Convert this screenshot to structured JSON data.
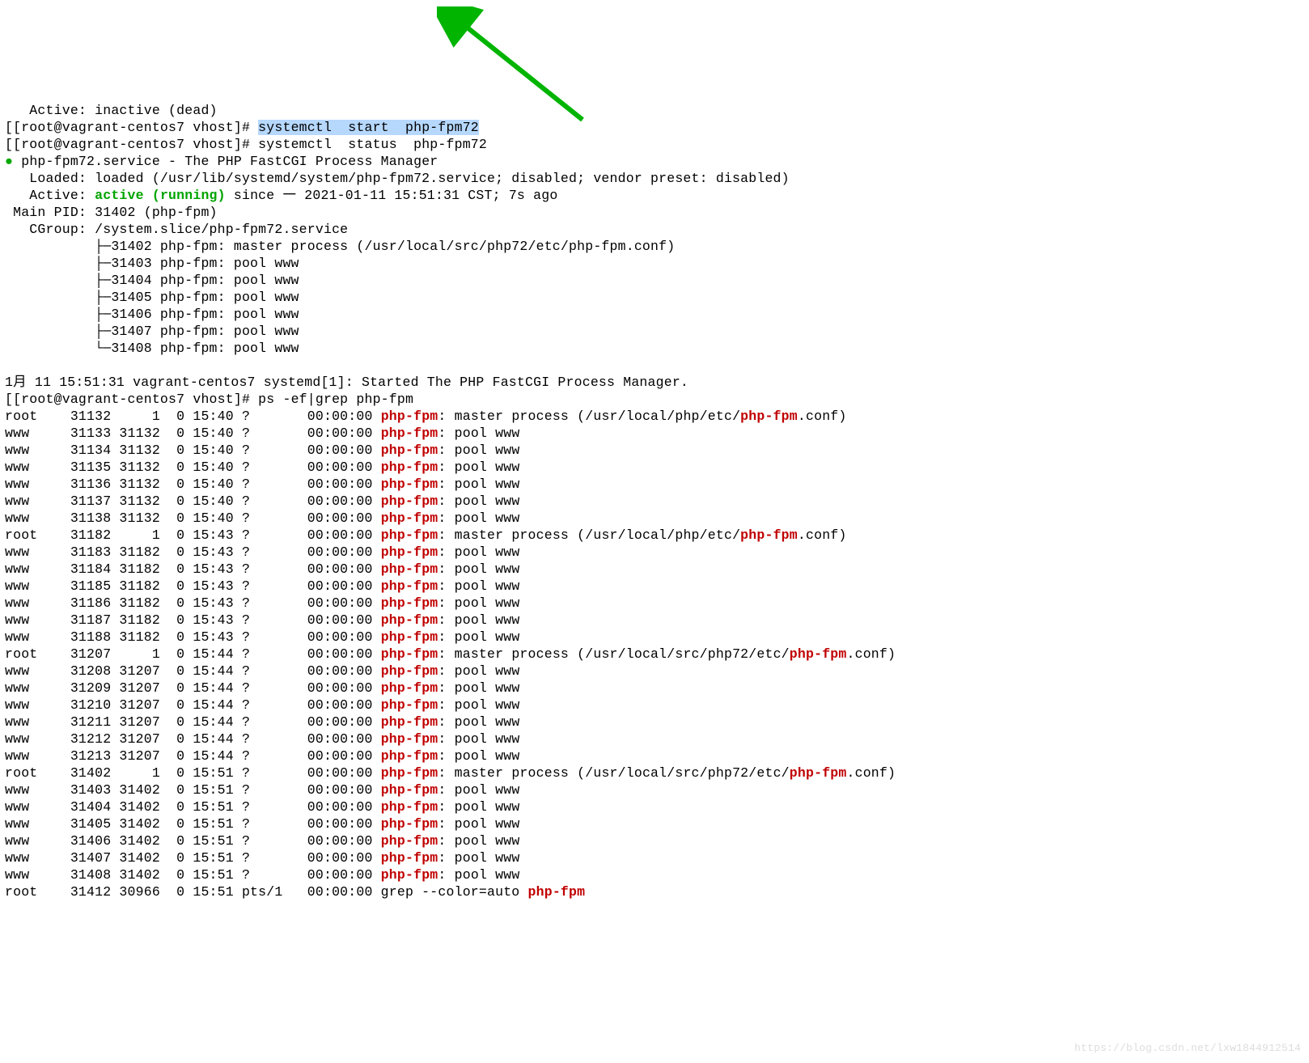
{
  "prompt": "[[root@vagrant-centos7 vhost]# ",
  "lines": {
    "l0": "   Active: inactive (dead)",
    "cmd_start_pre": "systemctl  start  php-fpm72",
    "cmd_status": "systemctl  status  php-fpm72",
    "svc_header_a": " php-fpm72.service - The PHP FastCGI Process Manager",
    "loaded": "   Loaded: loaded (/usr/lib/systemd/system/php-fpm72.service; disabled; vendor preset: disabled)",
    "active_a": "   Active: ",
    "active_b": "active (running)",
    "active_c": " since 一 2021-01-11 15:51:31 CST; 7s ago",
    "mainpid": " Main PID: 31402 (php-fpm)",
    "cgroup": "   CGroup: /system.slice/php-fpm72.service",
    "cg1": "           ├─31402 php-fpm: master process (/usr/local/src/php72/etc/php-fpm.conf)",
    "cg2": "           ├─31403 php-fpm: pool www",
    "cg3": "           ├─31404 php-fpm: pool www",
    "cg4": "           ├─31405 php-fpm: pool www",
    "cg5": "           ├─31406 php-fpm: pool www",
    "cg6": "           ├─31407 php-fpm: pool www",
    "cg7": "           └─31408 php-fpm: pool www",
    "log1": "1月 11 15:51:31 vagrant-centos7 systemd[1]: Started The PHP FastCGI Process Manager.",
    "cmd_ps": "ps -ef|grep php-fpm"
  },
  "ps_header": {
    "time_col": "00:00:00 ",
    "red": "php-fpm"
  },
  "ps": [
    {
      "u": "root",
      "pid": "31132",
      "ppid": "    1",
      "c": "0",
      "stime": "15:40",
      "tty": "?    ",
      "cmd_a": ": master process (/usr/local/php/etc/",
      "red2": "php-fpm",
      "cmd_b": ".conf)"
    },
    {
      "u": "www ",
      "pid": "31133",
      "ppid": "31132",
      "c": "0",
      "stime": "15:40",
      "tty": "?    ",
      "cmd_a": ": pool www",
      "red2": "",
      "cmd_b": ""
    },
    {
      "u": "www ",
      "pid": "31134",
      "ppid": "31132",
      "c": "0",
      "stime": "15:40",
      "tty": "?    ",
      "cmd_a": ": pool www",
      "red2": "",
      "cmd_b": ""
    },
    {
      "u": "www ",
      "pid": "31135",
      "ppid": "31132",
      "c": "0",
      "stime": "15:40",
      "tty": "?    ",
      "cmd_a": ": pool www",
      "red2": "",
      "cmd_b": ""
    },
    {
      "u": "www ",
      "pid": "31136",
      "ppid": "31132",
      "c": "0",
      "stime": "15:40",
      "tty": "?    ",
      "cmd_a": ": pool www",
      "red2": "",
      "cmd_b": ""
    },
    {
      "u": "www ",
      "pid": "31137",
      "ppid": "31132",
      "c": "0",
      "stime": "15:40",
      "tty": "?    ",
      "cmd_a": ": pool www",
      "red2": "",
      "cmd_b": ""
    },
    {
      "u": "www ",
      "pid": "31138",
      "ppid": "31132",
      "c": "0",
      "stime": "15:40",
      "tty": "?    ",
      "cmd_a": ": pool www",
      "red2": "",
      "cmd_b": ""
    },
    {
      "u": "root",
      "pid": "31182",
      "ppid": "    1",
      "c": "0",
      "stime": "15:43",
      "tty": "?    ",
      "cmd_a": ": master process (/usr/local/php/etc/",
      "red2": "php-fpm",
      "cmd_b": ".conf)"
    },
    {
      "u": "www ",
      "pid": "31183",
      "ppid": "31182",
      "c": "0",
      "stime": "15:43",
      "tty": "?    ",
      "cmd_a": ": pool www",
      "red2": "",
      "cmd_b": ""
    },
    {
      "u": "www ",
      "pid": "31184",
      "ppid": "31182",
      "c": "0",
      "stime": "15:43",
      "tty": "?    ",
      "cmd_a": ": pool www",
      "red2": "",
      "cmd_b": ""
    },
    {
      "u": "www ",
      "pid": "31185",
      "ppid": "31182",
      "c": "0",
      "stime": "15:43",
      "tty": "?    ",
      "cmd_a": ": pool www",
      "red2": "",
      "cmd_b": ""
    },
    {
      "u": "www ",
      "pid": "31186",
      "ppid": "31182",
      "c": "0",
      "stime": "15:43",
      "tty": "?    ",
      "cmd_a": ": pool www",
      "red2": "",
      "cmd_b": ""
    },
    {
      "u": "www ",
      "pid": "31187",
      "ppid": "31182",
      "c": "0",
      "stime": "15:43",
      "tty": "?    ",
      "cmd_a": ": pool www",
      "red2": "",
      "cmd_b": ""
    },
    {
      "u": "www ",
      "pid": "31188",
      "ppid": "31182",
      "c": "0",
      "stime": "15:43",
      "tty": "?    ",
      "cmd_a": ": pool www",
      "red2": "",
      "cmd_b": ""
    },
    {
      "u": "root",
      "pid": "31207",
      "ppid": "    1",
      "c": "0",
      "stime": "15:44",
      "tty": "?    ",
      "cmd_a": ": master process (/usr/local/src/php72/etc/",
      "red2": "php-fpm",
      "cmd_b": ".conf)"
    },
    {
      "u": "www ",
      "pid": "31208",
      "ppid": "31207",
      "c": "0",
      "stime": "15:44",
      "tty": "?    ",
      "cmd_a": ": pool www",
      "red2": "",
      "cmd_b": ""
    },
    {
      "u": "www ",
      "pid": "31209",
      "ppid": "31207",
      "c": "0",
      "stime": "15:44",
      "tty": "?    ",
      "cmd_a": ": pool www",
      "red2": "",
      "cmd_b": ""
    },
    {
      "u": "www ",
      "pid": "31210",
      "ppid": "31207",
      "c": "0",
      "stime": "15:44",
      "tty": "?    ",
      "cmd_a": ": pool www",
      "red2": "",
      "cmd_b": ""
    },
    {
      "u": "www ",
      "pid": "31211",
      "ppid": "31207",
      "c": "0",
      "stime": "15:44",
      "tty": "?    ",
      "cmd_a": ": pool www",
      "red2": "",
      "cmd_b": ""
    },
    {
      "u": "www ",
      "pid": "31212",
      "ppid": "31207",
      "c": "0",
      "stime": "15:44",
      "tty": "?    ",
      "cmd_a": ": pool www",
      "red2": "",
      "cmd_b": ""
    },
    {
      "u": "www ",
      "pid": "31213",
      "ppid": "31207",
      "c": "0",
      "stime": "15:44",
      "tty": "?    ",
      "cmd_a": ": pool www",
      "red2": "",
      "cmd_b": ""
    },
    {
      "u": "root",
      "pid": "31402",
      "ppid": "    1",
      "c": "0",
      "stime": "15:51",
      "tty": "?    ",
      "cmd_a": ": master process (/usr/local/src/php72/etc/",
      "red2": "php-fpm",
      "cmd_b": ".conf)"
    },
    {
      "u": "www ",
      "pid": "31403",
      "ppid": "31402",
      "c": "0",
      "stime": "15:51",
      "tty": "?    ",
      "cmd_a": ": pool www",
      "red2": "",
      "cmd_b": ""
    },
    {
      "u": "www ",
      "pid": "31404",
      "ppid": "31402",
      "c": "0",
      "stime": "15:51",
      "tty": "?    ",
      "cmd_a": ": pool www",
      "red2": "",
      "cmd_b": ""
    },
    {
      "u": "www ",
      "pid": "31405",
      "ppid": "31402",
      "c": "0",
      "stime": "15:51",
      "tty": "?    ",
      "cmd_a": ": pool www",
      "red2": "",
      "cmd_b": ""
    },
    {
      "u": "www ",
      "pid": "31406",
      "ppid": "31402",
      "c": "0",
      "stime": "15:51",
      "tty": "?    ",
      "cmd_a": ": pool www",
      "red2": "",
      "cmd_b": ""
    },
    {
      "u": "www ",
      "pid": "31407",
      "ppid": "31402",
      "c": "0",
      "stime": "15:51",
      "tty": "?    ",
      "cmd_a": ": pool www",
      "red2": "",
      "cmd_b": ""
    },
    {
      "u": "www ",
      "pid": "31408",
      "ppid": "31402",
      "c": "0",
      "stime": "15:51",
      "tty": "?    ",
      "cmd_a": ": pool www",
      "red2": "",
      "cmd_b": ""
    },
    {
      "u": "root",
      "pid": "31412",
      "ppid": "30966",
      "c": "0",
      "stime": "15:51",
      "tty": "pts/1",
      "cmd_a": "grep --color=auto ",
      "red2": "php-fpm",
      "cmd_b": "",
      "nogrep": true
    }
  ],
  "watermark": "https://blog.csdn.net/lxw1844912514",
  "colors": {
    "highlight": "#b7d8fd",
    "ok": "#00a400",
    "match": "#c00000",
    "arrow": "#00b400"
  }
}
